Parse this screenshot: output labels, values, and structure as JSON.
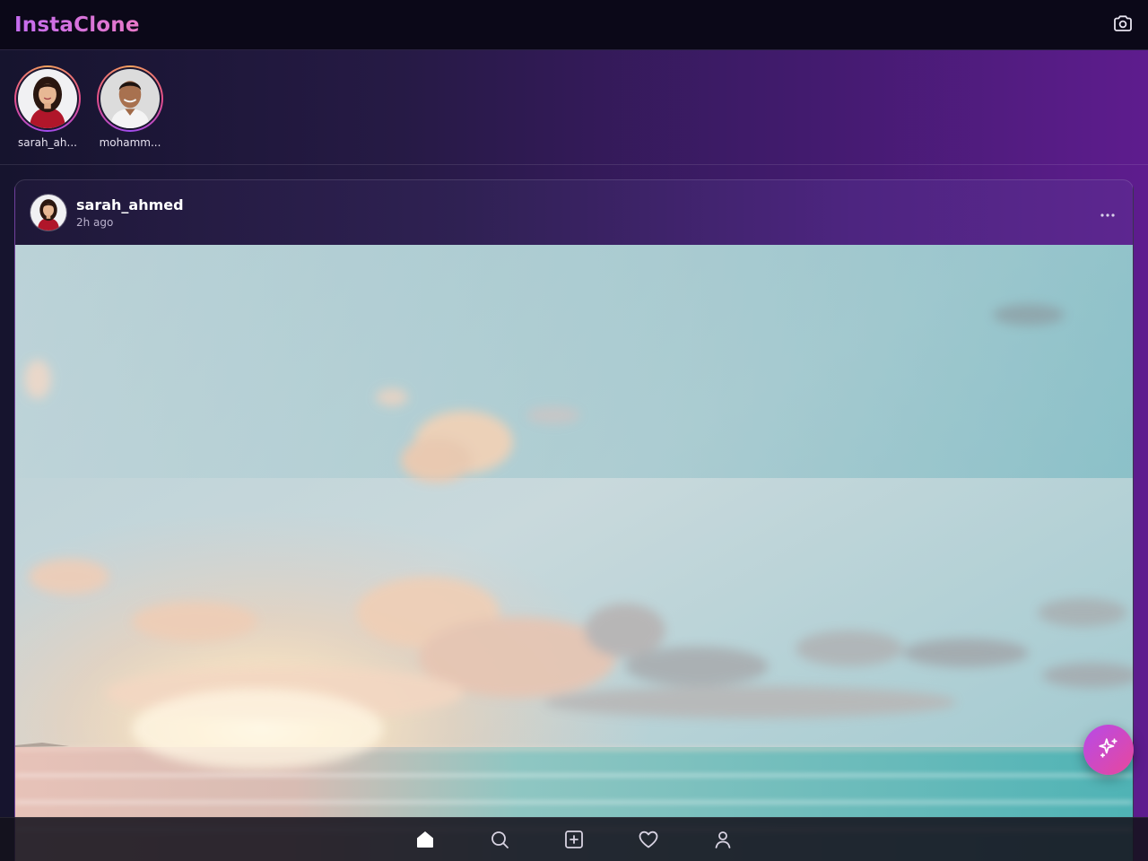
{
  "app": {
    "brand": "InstaClone",
    "colors": {
      "accent_start": "#c56cf0",
      "accent_end": "#e879c8",
      "fab_start": "#b64ae8",
      "fab_end": "#e8489c"
    }
  },
  "header": {
    "title": "InstaClone",
    "actions": [
      {
        "icon": "camera-icon"
      }
    ]
  },
  "stories": [
    {
      "username": "sarah_ah...",
      "avatar": "woman-portrait"
    },
    {
      "username": "mohamm...",
      "avatar": "man-portrait"
    }
  ],
  "post": {
    "username": "sarah_ahmed",
    "time": "2h ago",
    "menu_icon": "more-horizontal-icon",
    "image": "ocean-sunset-photo"
  },
  "fab": {
    "icon": "sparkles-icon"
  },
  "bottom_nav": {
    "items": [
      {
        "icon": "home-icon",
        "active": true
      },
      {
        "icon": "search-icon",
        "active": false
      },
      {
        "icon": "plus-square-icon",
        "active": false
      },
      {
        "icon": "heart-icon",
        "active": false
      },
      {
        "icon": "user-icon",
        "active": false
      }
    ]
  }
}
